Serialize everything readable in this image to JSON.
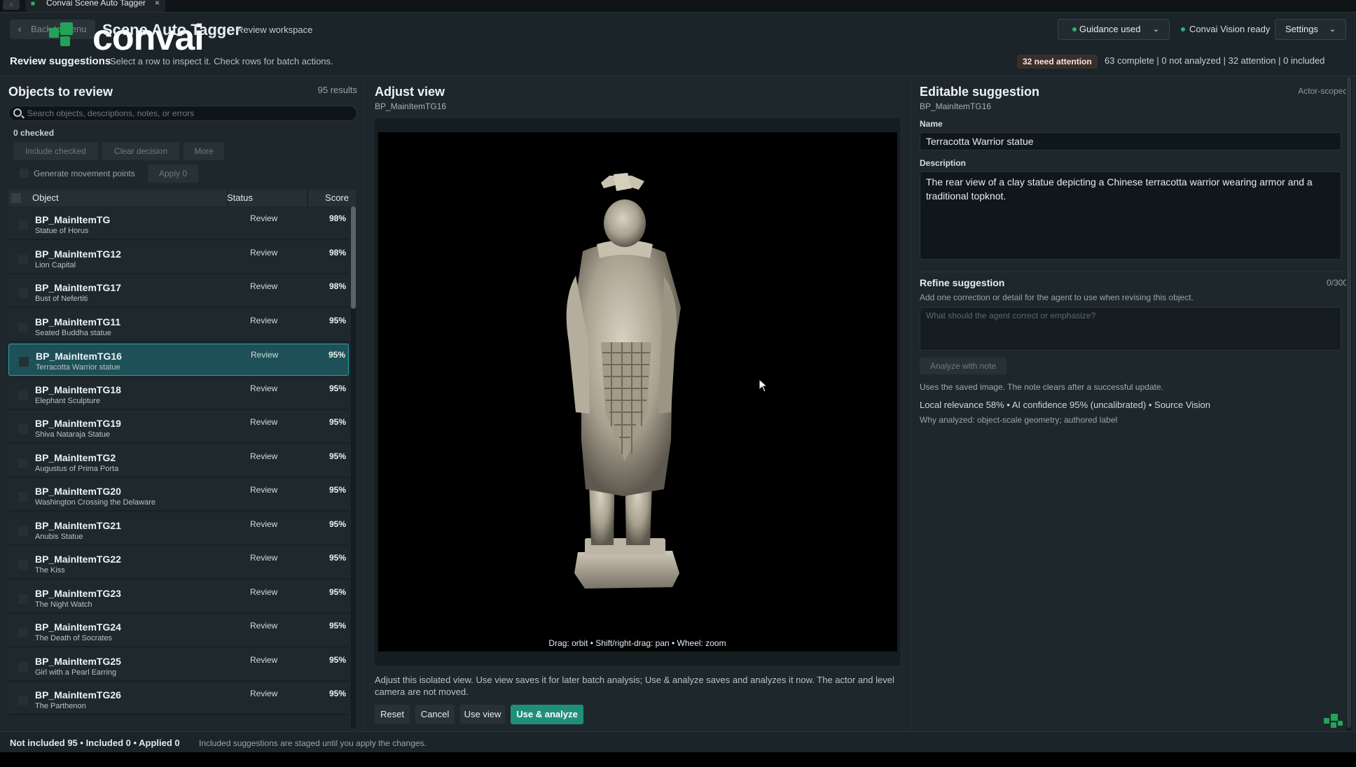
{
  "tab": {
    "title": "Convai Scene Auto Tagger",
    "close": "×",
    "system_icon": "⌂"
  },
  "header": {
    "back_label": "Back to menu",
    "brand": "convai",
    "title": "Scene Auto Tagger",
    "workspace": "Review workspace",
    "guidance_label": "Guidance used",
    "vision_status": "Convai Vision ready",
    "settings_label": "Settings",
    "review_title": "Review suggestions",
    "review_hint": "Select a row to inspect it. Check rows for batch actions.",
    "attention_badge": "32 need attention",
    "summary": "63 complete  |  0 not analyzed  |  32 attention  |  0 included"
  },
  "objects": {
    "title": "Objects to review",
    "results": "95 results",
    "search_placeholder": "Search objects, descriptions, notes, or errors",
    "checked": "0 checked",
    "include_checked": "Include checked",
    "clear_decision": "Clear decision",
    "more": "More",
    "movement_label": "Generate movement points",
    "apply_label": "Apply 0",
    "columns": {
      "object": "Object",
      "status": "Status",
      "score": "Score"
    },
    "rows": [
      {
        "name": "BP_MainItemTG",
        "sub": "Statue of Horus",
        "status": "Review",
        "score": "98%"
      },
      {
        "name": "BP_MainItemTG12",
        "sub": "Lion Capital",
        "status": "Review",
        "score": "98%"
      },
      {
        "name": "BP_MainItemTG17",
        "sub": "Bust of Nefertiti",
        "status": "Review",
        "score": "98%"
      },
      {
        "name": "BP_MainItemTG11",
        "sub": "Seated Buddha statue",
        "status": "Review",
        "score": "95%"
      },
      {
        "name": "BP_MainItemTG16",
        "sub": "Terracotta Warrior statue",
        "status": "Review",
        "score": "95%",
        "selected": true
      },
      {
        "name": "BP_MainItemTG18",
        "sub": "Elephant Sculpture",
        "status": "Review",
        "score": "95%"
      },
      {
        "name": "BP_MainItemTG19",
        "sub": "Shiva Nataraja Statue",
        "status": "Review",
        "score": "95%"
      },
      {
        "name": "BP_MainItemTG2",
        "sub": "Augustus of Prima Porta",
        "status": "Review",
        "score": "95%"
      },
      {
        "name": "BP_MainItemTG20",
        "sub": "Washington Crossing the Delaware",
        "status": "Review",
        "score": "95%"
      },
      {
        "name": "BP_MainItemTG21",
        "sub": "Anubis Statue",
        "status": "Review",
        "score": "95%"
      },
      {
        "name": "BP_MainItemTG22",
        "sub": "The Kiss",
        "status": "Review",
        "score": "95%"
      },
      {
        "name": "BP_MainItemTG23",
        "sub": "The Night Watch",
        "status": "Review",
        "score": "95%"
      },
      {
        "name": "BP_MainItemTG24",
        "sub": "The Death of Socrates",
        "status": "Review",
        "score": "95%"
      },
      {
        "name": "BP_MainItemTG25",
        "sub": "Girl with a Pearl Earring",
        "status": "Review",
        "score": "95%"
      },
      {
        "name": "BP_MainItemTG26",
        "sub": "The Parthenon",
        "status": "Review",
        "score": "95%"
      }
    ]
  },
  "adjust": {
    "title": "Adjust view",
    "subtitle": "BP_MainItemTG16",
    "viewport_hint": "Drag: orbit  •  Shift/right-drag: pan  •  Wheel: zoom",
    "hint": "Adjust this isolated view. Use view saves it for later batch analysis; Use & analyze saves and analyzes it now. The actor and level camera are not moved.",
    "reset": "Reset",
    "cancel": "Cancel",
    "use_view": "Use view",
    "use_analyze": "Use & analyze"
  },
  "editable": {
    "title": "Editable suggestion",
    "subtitle": "BP_MainItemTG16",
    "scope": "Actor-scoped",
    "name_label": "Name",
    "name_value": "Terracotta Warrior statue",
    "description_label": "Description",
    "description_value": "The rear view of a clay statue depicting a Chinese terracotta warrior wearing armor and a traditional topknot.",
    "refine_title": "Refine suggestion",
    "refine_count": "0/300",
    "refine_hint": "Add one correction or detail for the agent to use when revising this object.",
    "refine_placeholder": "What should the agent correct or emphasize?",
    "analyze_note": "Analyze with note",
    "saved_hint": "Uses the saved image. The note clears after a successful update.",
    "relevance": "Local relevance 58%  •  AI confidence 95% (uncalibrated)  •  Source Vision",
    "why": "Why analyzed: object-scale geometry; authored label"
  },
  "footer": {
    "counts": "Not included 95  •  Included 0  •  Applied 0",
    "hint": "Included suggestions are staged until you apply the changes."
  },
  "colors": {
    "accent": "#1f8f7c",
    "selection": "#1d5157",
    "brand_green": "#23a35a"
  }
}
